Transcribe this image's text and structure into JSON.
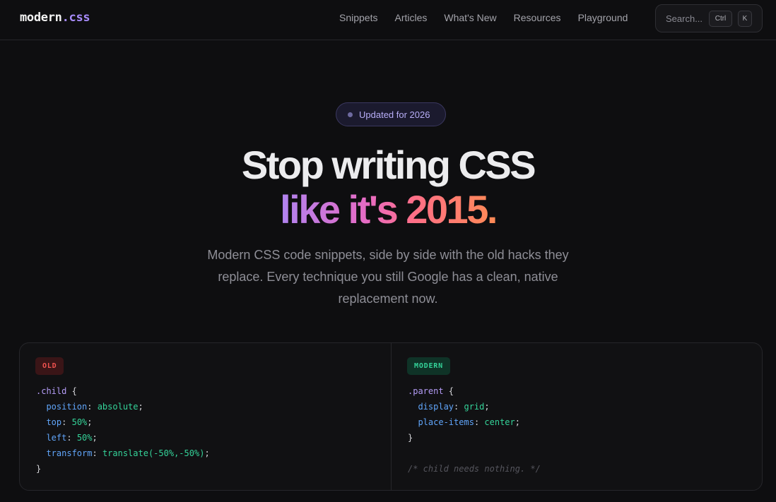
{
  "header": {
    "logo_main": "modern",
    "logo_accent": ".css",
    "nav": [
      "Snippets",
      "Articles",
      "What's New",
      "Resources",
      "Playground"
    ],
    "search": {
      "placeholder": "Search...",
      "shortcut_ctrl": "Ctrl",
      "shortcut_key": "K"
    }
  },
  "hero": {
    "badge": "Updated for 2026",
    "headline_line1": "Stop writing CSS",
    "headline_line2": "like it's 2015.",
    "subtitle": "Modern CSS code snippets, side by side with the old hacks they replace. Every technique you still Google has a clean, native replacement now."
  },
  "comparison": {
    "old": {
      "tag": "OLD",
      "selector": ".child",
      "open": " {",
      "close": "}",
      "decls": [
        {
          "prop": "position",
          "value": "absolute"
        },
        {
          "prop": "top",
          "value": "50%"
        },
        {
          "prop": "left",
          "value": "50%"
        },
        {
          "prop": "transform",
          "value": "translate(-50%,-50%)"
        }
      ]
    },
    "modern": {
      "tag": "MODERN",
      "selector": ".parent",
      "open": " {",
      "close": "}",
      "decls": [
        {
          "prop": "display",
          "value": "grid"
        },
        {
          "prop": "place-items",
          "value": "center"
        }
      ],
      "comment": "/* child needs nothing. */"
    }
  },
  "colors": {
    "background": "#0e0e10",
    "accent_purple": "#a78bfa",
    "old_red": "#f0524f",
    "modern_green": "#34d399",
    "property_blue": "#60a5fa"
  }
}
